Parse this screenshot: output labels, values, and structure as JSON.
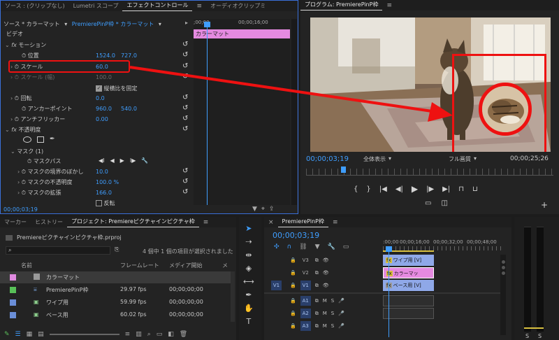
{
  "effect_controls": {
    "tabs": [
      "ソース : (クリップなし)",
      "Lumetri スコープ",
      "エフェクトコントロール",
      "オーディオクリップミ"
    ],
    "source_label": "ソース * カラーマット",
    "sequence_link": "PremierePinP枠 * カラーマット",
    "section_video": "ビデオ",
    "motion": "モーション",
    "position": {
      "label": "位置",
      "x": "1524.0",
      "y": "727.0"
    },
    "scale": {
      "label": "スケール",
      "value": "60.0"
    },
    "scale_width": {
      "label": "スケール (幅)",
      "value": "100.0"
    },
    "uniform_scale": "縦横比を固定",
    "rotation": {
      "label": "回転",
      "value": "0.0"
    },
    "anchor": {
      "label": "アンカーポイント",
      "x": "960.0",
      "y": "540.0"
    },
    "antiflicker": {
      "label": "アンチフリッカー",
      "value": "0.00"
    },
    "opacity": "不透明度",
    "mask": "マスク (1)",
    "mask_path": "マスクパス",
    "mask_feather": {
      "label": "マスクの境界のぼかし",
      "value": "10.0"
    },
    "mask_opacity": {
      "label": "マスクの不透明度",
      "value": "100.0 %"
    },
    "mask_expansion": {
      "label": "マスクの拡張",
      "value": "166.0"
    },
    "inverted": "反転",
    "timecode": "00;00;03;19",
    "ruler_start": ";00;00",
    "ruler_mid": "00;00;16;00",
    "clip_label": "カラーマット"
  },
  "program": {
    "title": "プログラム: PremierePinP枠",
    "timecode": "00;00;03;19",
    "zoom": "全体表示",
    "quality": "フル画質",
    "duration": "00;00;25;26"
  },
  "project": {
    "tabs": [
      "マーカー",
      "ヒストリー",
      "プロジェクト: Premiereピクチャインピクチャ枠"
    ],
    "file": "Premiereピクチャインピクチャ枠.prproj",
    "selection_info": "4 個中 1 個の項目が選択されました",
    "col_name": "名前",
    "col_fps": "フレームレート",
    "col_start": "メディア開始",
    "col_more": "メ",
    "items": [
      {
        "name": "カラーマット",
        "fps": "",
        "start": "",
        "color": "#e08ae0"
      },
      {
        "name": "PremierePinP枠",
        "fps": "29.97 fps",
        "start": "00;00;00;00",
        "color": "#58c058"
      },
      {
        "name": "ワイプ用",
        "fps": "59.99 fps",
        "start": "00;00;00;00",
        "color": "#6a8ed8"
      },
      {
        "name": "ベース用",
        "fps": "60.02 fps",
        "start": "00;00;00;00",
        "color": "#6a8ed8"
      }
    ]
  },
  "timeline": {
    "title": "PremierePinP枠",
    "timecode": "00;00;03;19",
    "ruler": [
      ":00;00",
      "00;00;16;00",
      "00;00;32;00",
      "00;00;48;00"
    ],
    "video_tracks": [
      {
        "src": "",
        "name": "V3"
      },
      {
        "src": "",
        "name": "V2"
      },
      {
        "src": "V1",
        "name": "V1"
      }
    ],
    "audio_tracks": [
      {
        "name": "A1"
      },
      {
        "name": "A2"
      },
      {
        "name": "A3"
      }
    ],
    "clips": [
      {
        "label": "ワイプ用 [V]",
        "color": "#8fa8e8"
      },
      {
        "label": "カラーマッ",
        "color": "#e58ae0"
      },
      {
        "label": "ベース用 [V]",
        "color": "#8fa8e8"
      }
    ],
    "m_label": "M",
    "s_label": "S"
  },
  "meter": {
    "s_left": "S",
    "s_right": "S"
  },
  "colors": {
    "accent_blue": "#3f9eff",
    "annotation_red": "#ee1111",
    "clip_pink": "#e58ae0"
  }
}
